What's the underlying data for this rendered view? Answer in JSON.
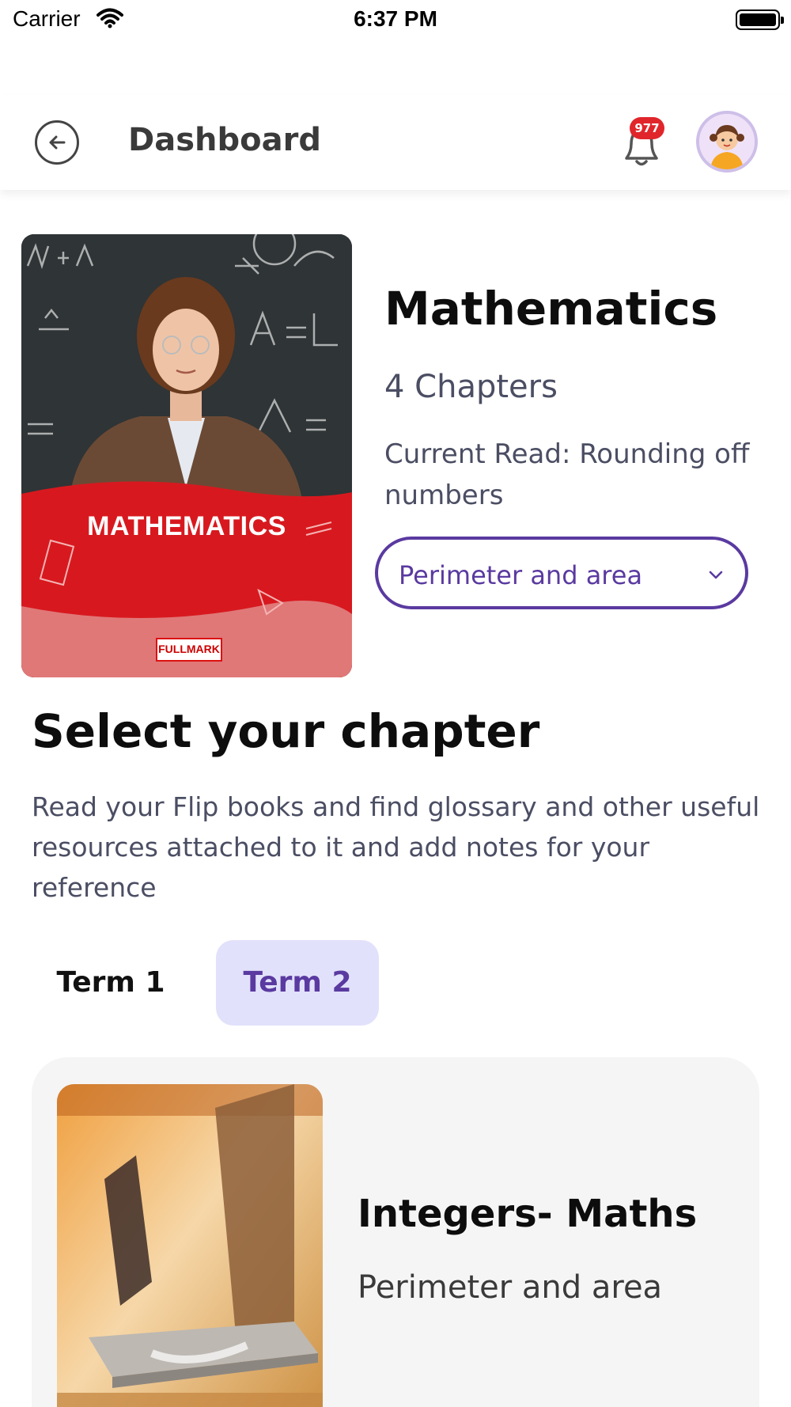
{
  "status_bar": {
    "carrier": "Carrier",
    "time": "6:37 PM",
    "icons": [
      "wifi-icon",
      "battery-icon"
    ]
  },
  "header": {
    "title": "Dashboard",
    "back_icon": "arrow-left-circle-icon",
    "notification_icon": "bell-icon",
    "notification_count": "977",
    "avatar_icon": "girl-avatar"
  },
  "subject": {
    "cover_title": "MATHEMATICS",
    "cover_logo": "FULLMARK",
    "name": "Mathematics",
    "chapters": "4 Chapters",
    "current_read": "Current Read: Rounding off numbers",
    "selected_chapter": "Perimeter and area",
    "accent_color": "#5a3aa0",
    "cover_color": "#d7191f"
  },
  "section": {
    "title": "Select your chapter",
    "description": "Read your Flip books and find glossary and other useful resources attached to it and add notes for your reference"
  },
  "tabs": [
    {
      "label": "Term 1",
      "selected": false
    },
    {
      "label": "Term 2",
      "selected": true
    }
  ],
  "chapter_cards": [
    {
      "title": "Integers- Maths",
      "subtitle": "Perimeter and area"
    }
  ]
}
